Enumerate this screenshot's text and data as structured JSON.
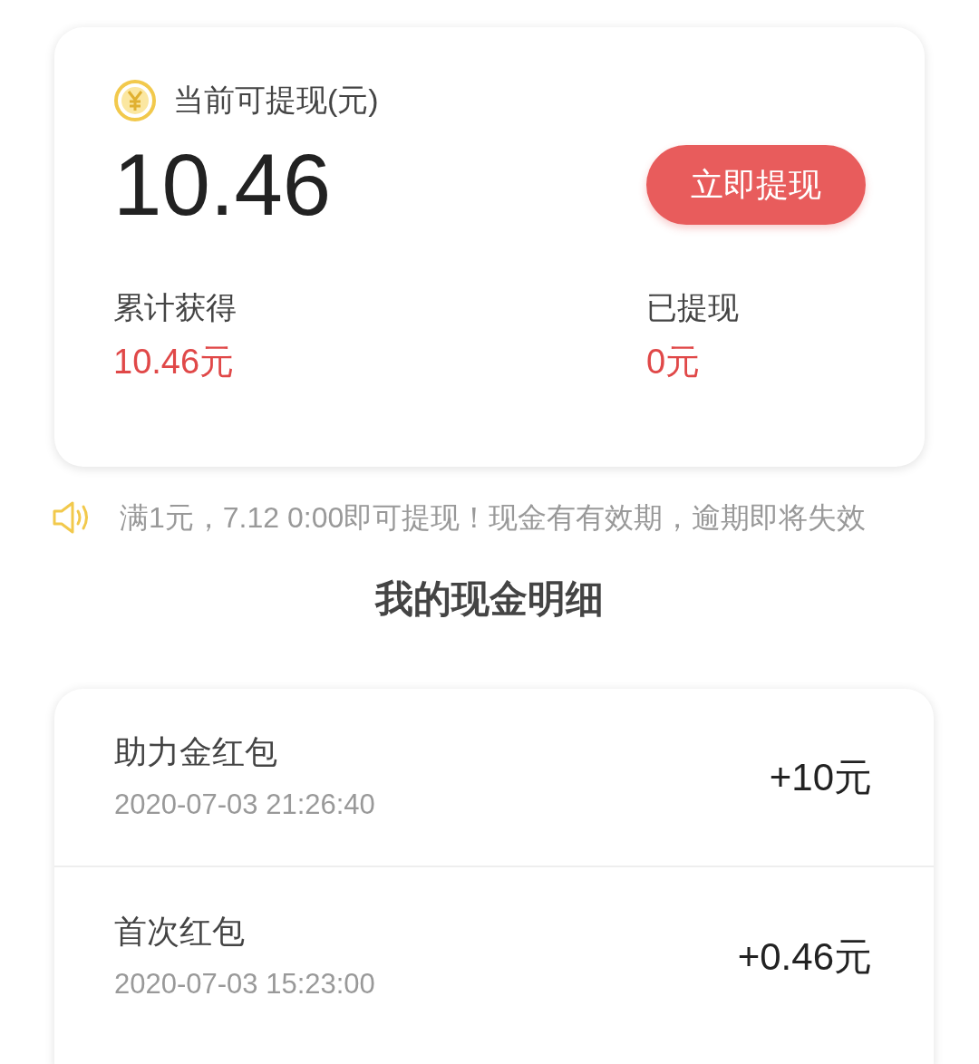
{
  "balance_card": {
    "label": "当前可提现(元)",
    "amount": "10.46",
    "withdraw_button": "立即提现",
    "stats": [
      {
        "label": "累计获得",
        "value": "10.46元"
      },
      {
        "label": "已提现",
        "value": "0元"
      }
    ]
  },
  "notice": "满1元，7.12 0:00即可提现！现金有有效期，逾期即将失效",
  "section_title": "我的现金明细",
  "records": [
    {
      "title": "助力金红包",
      "time": "2020-07-03 21:26:40",
      "amount": "+10元"
    },
    {
      "title": "首次红包",
      "time": "2020-07-03 15:23:00",
      "amount": "+0.46元"
    }
  ]
}
